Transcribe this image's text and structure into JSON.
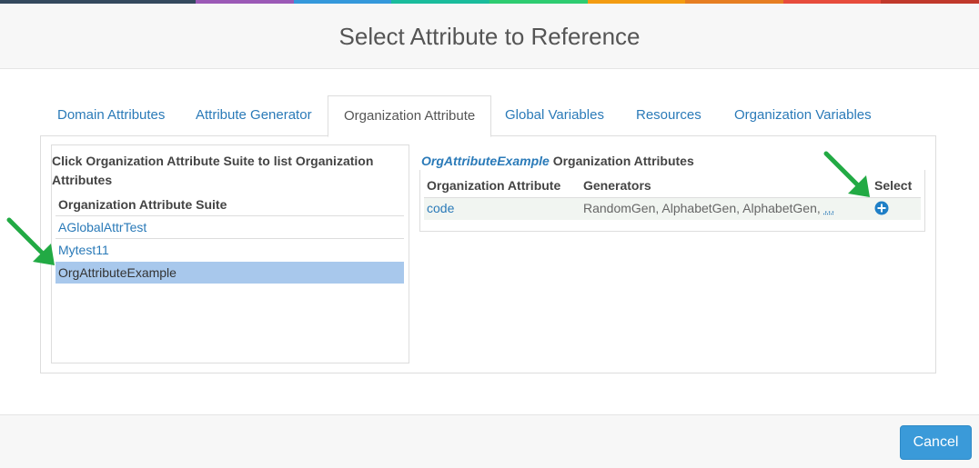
{
  "dialog": {
    "title": "Select Attribute to Reference"
  },
  "colors": {
    "rainbow": [
      "#34495e",
      "#34495e",
      "#9b59b6",
      "#3498db",
      "#1abc9c",
      "#2ecc71",
      "#f39c12",
      "#e67e22",
      "#e74c3c",
      "#c0392b"
    ],
    "link": "#2a7ab8",
    "selected_row": "#a8c8ec",
    "arrow": "#22aa44",
    "button": "#3a9ad9"
  },
  "tabs": [
    {
      "label": "Domain Attributes",
      "active": false
    },
    {
      "label": "Attribute Generator",
      "active": false
    },
    {
      "label": "Organization Attribute",
      "active": true
    },
    {
      "label": "Global Variables",
      "active": false
    },
    {
      "label": "Resources",
      "active": false
    },
    {
      "label": "Organization Variables",
      "active": false
    }
  ],
  "left_panel": {
    "heading": "Click Organization Attribute Suite to list Organization Attributes",
    "column_header": "Organization Attribute Suite",
    "suites": [
      {
        "label": "AGlobalAttrTest",
        "selected": false
      },
      {
        "label": "Mytest11",
        "selected": false
      },
      {
        "label": "OrgAttributeExample",
        "selected": true
      }
    ]
  },
  "right_panel": {
    "suite_name": "OrgAttributeExample",
    "heading_suffix": " Organization Attributes",
    "columns": {
      "attribute": "Organization Attribute",
      "generators": "Generators",
      "select": "Select"
    },
    "rows": [
      {
        "attribute": "code",
        "generators": "RandomGen, AlphabetGen, AlphabetGen,",
        "more": "...",
        "select_icon": "plus-circle-icon"
      }
    ]
  },
  "footer": {
    "cancel_label": "Cancel"
  }
}
